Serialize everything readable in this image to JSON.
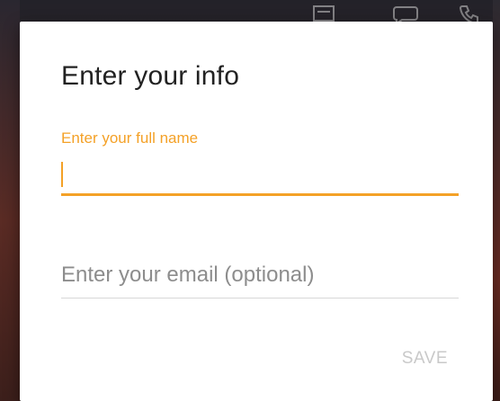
{
  "dialog": {
    "title": "Enter your info",
    "name_field": {
      "label": "Enter your full name",
      "value": ""
    },
    "email_field": {
      "placeholder": "Enter your email (optional)",
      "value": ""
    },
    "save_label": "SAVE"
  },
  "background_icons": [
    "battery-icon",
    "chat-icon",
    "phone-icon"
  ],
  "colors": {
    "accent": "#f4a127",
    "disabled_text": "#c9c9c9",
    "dialog_background": "#ffffff",
    "title_text": "#222222"
  }
}
